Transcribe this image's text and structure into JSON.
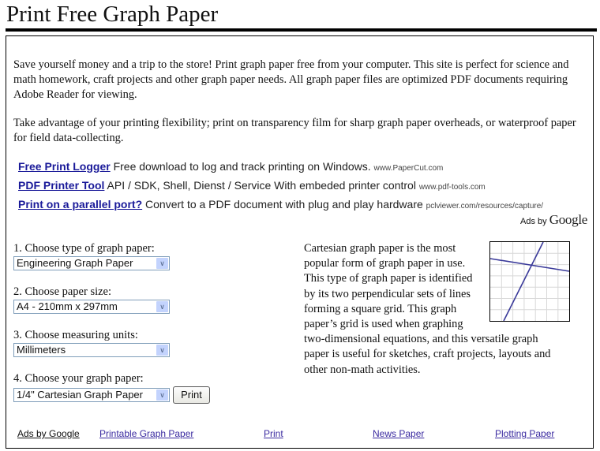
{
  "page": {
    "title": "Print Free Graph Paper"
  },
  "intro": {
    "paragraph1": "Save yourself money and a trip to the store! Print graph paper free from your computer. This site is perfect for science and math homework, craft projects and other graph paper needs. All graph paper files are optimized PDF documents requiring Adobe Reader for viewing.",
    "paragraph2": "Take advantage of your printing flexibility; print on transparency film for sharp graph paper overheads, or waterproof paper for field data-collecting."
  },
  "ads": {
    "items": [
      {
        "title": "Free Print Logger",
        "text": "Free download to log and track printing on Windows.",
        "url": "www.PaperCut.com"
      },
      {
        "title": "PDF Printer Tool",
        "text": "API / SDK, Shell, Dienst / Service With embeded printer control",
        "url": "www.pdf-tools.com"
      },
      {
        "title": "Print on a parallel port?",
        "text": "Convert to a PDF document with plug and play hardware",
        "url": "pclviewer.com/resources/capture/"
      }
    ],
    "ads_by_label": "Ads by",
    "google_label": "Google"
  },
  "form": {
    "step1": {
      "label": "1. Choose type of graph paper:",
      "value": "Engineering Graph Paper"
    },
    "step2": {
      "label": "2. Choose paper size:",
      "value": "A4 - 210mm x 297mm"
    },
    "step3": {
      "label": "3. Choose measuring units:",
      "value": "Millimeters"
    },
    "step4": {
      "label": "4. Choose your graph paper:",
      "value": "1/4\" Cartesian Graph Paper"
    },
    "print_label": "Print",
    "arrow_icon": "chevron-down"
  },
  "description": {
    "text": "Cartesian graph paper is the most popular form of graph paper in use. This type of graph paper is identified by its two perpendicular sets of lines forming a square grid. This graph paper’s grid is used when graphing two-dimensional equations, and this versatile graph paper is useful for sketches, craft projects, layouts and other non-math activities.",
    "image": "cartesian-graph-paper-sample"
  },
  "footer": {
    "ads_by_google": "Ads by Google",
    "links": [
      "Printable Graph Paper",
      "Print",
      "News Paper",
      "Plotting Paper"
    ]
  },
  "colors": {
    "ad_link": "#1a1a99",
    "footer_link": "#3a2aa0",
    "graph_line": "#3a3a9a",
    "grid_line": "#d8d8d8"
  }
}
